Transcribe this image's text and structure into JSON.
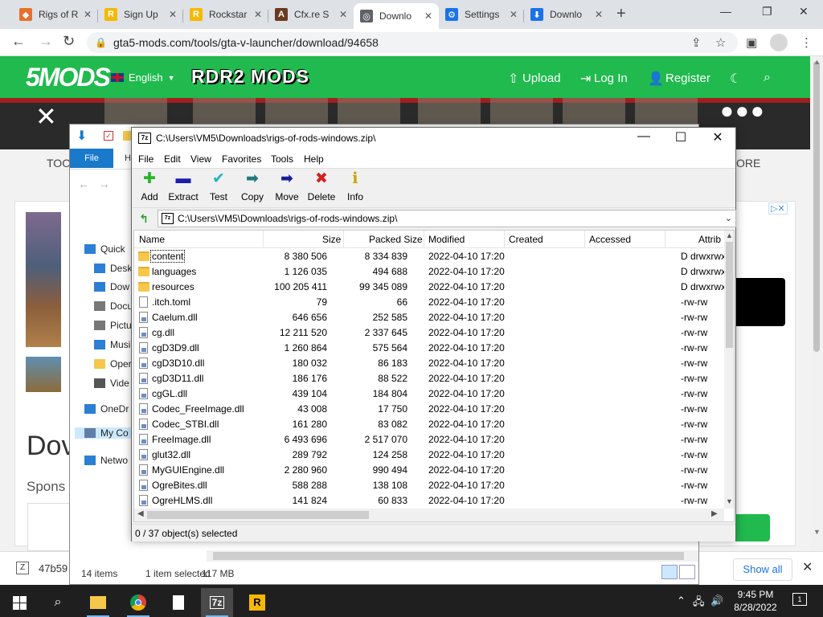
{
  "browser": {
    "tabs": [
      {
        "title": "Rigs of R",
        "fav_color": "#e8702a",
        "fav_glyph": "◆"
      },
      {
        "title": "Sign Up",
        "fav_color": "#f6b800",
        "fav_glyph": "R"
      },
      {
        "title": "Rockstar",
        "fav_color": "#f6b800",
        "fav_glyph": "R"
      },
      {
        "title": "Cfx.re S",
        "fav_color": "#6b3a1e",
        "fav_glyph": "A"
      },
      {
        "title": "Downlo",
        "fav_color": "#5f6368",
        "fav_glyph": "◎"
      },
      {
        "title": "Settings",
        "fav_color": "#1a73e8",
        "fav_glyph": "⚙"
      },
      {
        "title": "Downlo",
        "fav_color": "#1a73e8",
        "fav_glyph": "⬇"
      }
    ],
    "url": "gta5-mods.com/tools/gta-v-launcher/download/94658"
  },
  "site": {
    "logo": "5MODS",
    "language": "English",
    "rdr2_logo": "RDR2 MODS",
    "upload": "Upload",
    "login": "Log In",
    "register": "Register",
    "tools_tab": "TOO",
    "more_tab": "ORE",
    "download_heading": "Dov",
    "sponsored": "Spons",
    "ad_close": "▷✕"
  },
  "download_shelf": {
    "item": "47b59",
    "show_all": "Show all"
  },
  "explorer": {
    "file_tab": "File",
    "h_tab": "H",
    "sidebar": [
      {
        "label": "Quick",
        "color": "#2b7fd4"
      },
      {
        "label": "Desk",
        "color": "#2b7fd4"
      },
      {
        "label": "Dow",
        "color": "#2b7fd4"
      },
      {
        "label": "Docu",
        "color": "#777777"
      },
      {
        "label": "Pictu",
        "color": "#777777"
      },
      {
        "label": "Musi",
        "color": "#2b7fd4"
      },
      {
        "label": "Oper",
        "color": "#f5c84c"
      },
      {
        "label": "Vide",
        "color": "#555555"
      },
      {
        "label": "OneDr",
        "color": "#2b7fd4"
      },
      {
        "label": "My Co",
        "color": "#5f7fa8"
      },
      {
        "label": "Netwo",
        "color": "#2b7fd4"
      }
    ],
    "status_items": "14 items",
    "status_selected": "1 item selected",
    "status_size": "117 MB"
  },
  "sevenzip": {
    "title": "C:\\Users\\VM5\\Downloads\\rigs-of-rods-windows.zip\\",
    "app_icon": "7z",
    "menu": [
      "File",
      "Edit",
      "View",
      "Favorites",
      "Tools",
      "Help"
    ],
    "toolbar": [
      {
        "label": "Add",
        "icon": "✚",
        "color": "#2ab42a"
      },
      {
        "label": "Extract",
        "icon": "▬",
        "color": "#1c1ca8"
      },
      {
        "label": "Test",
        "icon": "✔",
        "color": "#1fb3c4"
      },
      {
        "label": "Copy",
        "icon": "➡",
        "color": "#1f7a7a"
      },
      {
        "label": "Move",
        "icon": "➡",
        "color": "#1c1c9a"
      },
      {
        "label": "Delete",
        "icon": "✖",
        "color": "#d61f1f"
      },
      {
        "label": "Info",
        "icon": "ℹ",
        "color": "#c9a400"
      }
    ],
    "path": "C:\\Users\\VM5\\Downloads\\rigs-of-rods-windows.zip\\",
    "columns": {
      "name": "Name",
      "size": "Size",
      "packed": "Packed Size",
      "modified": "Modified",
      "created": "Created",
      "accessed": "Accessed",
      "attributes": "Attrib"
    },
    "rows": [
      {
        "name": "content",
        "type": "folder",
        "size": "8 380 506",
        "packed": "8 334 839",
        "modified": "2022-04-10 17:20",
        "attr": "D drwxrwx"
      },
      {
        "name": "languages",
        "type": "folder",
        "size": "1 126 035",
        "packed": "494 688",
        "modified": "2022-04-10 17:20",
        "attr": "D drwxrwx"
      },
      {
        "name": "resources",
        "type": "folder",
        "size": "100 205 411",
        "packed": "99 345 089",
        "modified": "2022-04-10 17:20",
        "attr": "D drwxrwx"
      },
      {
        "name": ".itch.toml",
        "type": "doc",
        "size": "79",
        "packed": "66",
        "modified": "2022-04-10 17:20",
        "attr": "-rw-rw"
      },
      {
        "name": "Caelum.dll",
        "type": "dll",
        "size": "646 656",
        "packed": "252 585",
        "modified": "2022-04-10 17:20",
        "attr": "-rw-rw"
      },
      {
        "name": "cg.dll",
        "type": "dll",
        "size": "12 211 520",
        "packed": "2 337 645",
        "modified": "2022-04-10 17:20",
        "attr": "-rw-rw"
      },
      {
        "name": "cgD3D9.dll",
        "type": "dll",
        "size": "1 260 864",
        "packed": "575 564",
        "modified": "2022-04-10 17:20",
        "attr": "-rw-rw"
      },
      {
        "name": "cgD3D10.dll",
        "type": "dll",
        "size": "180 032",
        "packed": "86 183",
        "modified": "2022-04-10 17:20",
        "attr": "-rw-rw"
      },
      {
        "name": "cgD3D11.dll",
        "type": "dll",
        "size": "186 176",
        "packed": "88 522",
        "modified": "2022-04-10 17:20",
        "attr": "-rw-rw"
      },
      {
        "name": "cgGL.dll",
        "type": "dll",
        "size": "439 104",
        "packed": "184 804",
        "modified": "2022-04-10 17:20",
        "attr": "-rw-rw"
      },
      {
        "name": "Codec_FreeImage.dll",
        "type": "dll",
        "size": "43 008",
        "packed": "17 750",
        "modified": "2022-04-10 17:20",
        "attr": "-rw-rw"
      },
      {
        "name": "Codec_STBI.dll",
        "type": "dll",
        "size": "161 280",
        "packed": "83 082",
        "modified": "2022-04-10 17:20",
        "attr": "-rw-rw"
      },
      {
        "name": "FreeImage.dll",
        "type": "dll",
        "size": "6 493 696",
        "packed": "2 517 070",
        "modified": "2022-04-10 17:20",
        "attr": "-rw-rw"
      },
      {
        "name": "glut32.dll",
        "type": "dll",
        "size": "289 792",
        "packed": "124 258",
        "modified": "2022-04-10 17:20",
        "attr": "-rw-rw"
      },
      {
        "name": "MyGUIEngine.dll",
        "type": "dll",
        "size": "2 280 960",
        "packed": "990 494",
        "modified": "2022-04-10 17:20",
        "attr": "-rw-rw"
      },
      {
        "name": "OgreBites.dll",
        "type": "dll",
        "size": "588 288",
        "packed": "138 108",
        "modified": "2022-04-10 17:20",
        "attr": "-rw-rw"
      },
      {
        "name": "OgreHLMS.dll",
        "type": "dll",
        "size": "141 824",
        "packed": "60 833",
        "modified": "2022-04-10 17:20",
        "attr": "-rw-rw"
      }
    ],
    "status": "0 / 37 object(s) selected"
  },
  "taskbar": {
    "time": "9:45 PM",
    "date": "8/28/2022",
    "notifications": "1",
    "app_7z": "7z",
    "app_rockstar": "R"
  }
}
